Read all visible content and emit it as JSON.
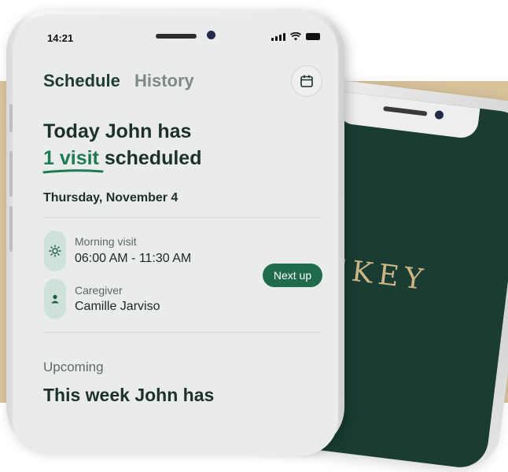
{
  "status_bar": {
    "time": "14:21"
  },
  "tabs": {
    "schedule": "Schedule",
    "history": "History"
  },
  "headline": {
    "line1": "Today John has",
    "count_text": "1 visit",
    "rest_text": " scheduled"
  },
  "date": "Thursday, November 4",
  "visit": {
    "morning_label": "Morning visit",
    "morning_time": "06:00 AM - 11:30 AM",
    "caregiver_label": "Caregiver",
    "caregiver_name": "Camille Jarviso",
    "status_badge": "Next up"
  },
  "upcoming": {
    "label": "Upcoming",
    "headline": "This week John has"
  },
  "back_phone": {
    "brand_text": "EKEY"
  },
  "colors": {
    "accent_green": "#1e7a55",
    "badge_green": "#1f6b4c",
    "back_screen": "#1a3c33",
    "brand_gold": "#cdb685",
    "tan_background": "#d8c39b"
  },
  "icons": [
    "calendar-icon",
    "sun-icon",
    "person-icon",
    "signal-icon",
    "wifi-icon",
    "battery-icon"
  ]
}
